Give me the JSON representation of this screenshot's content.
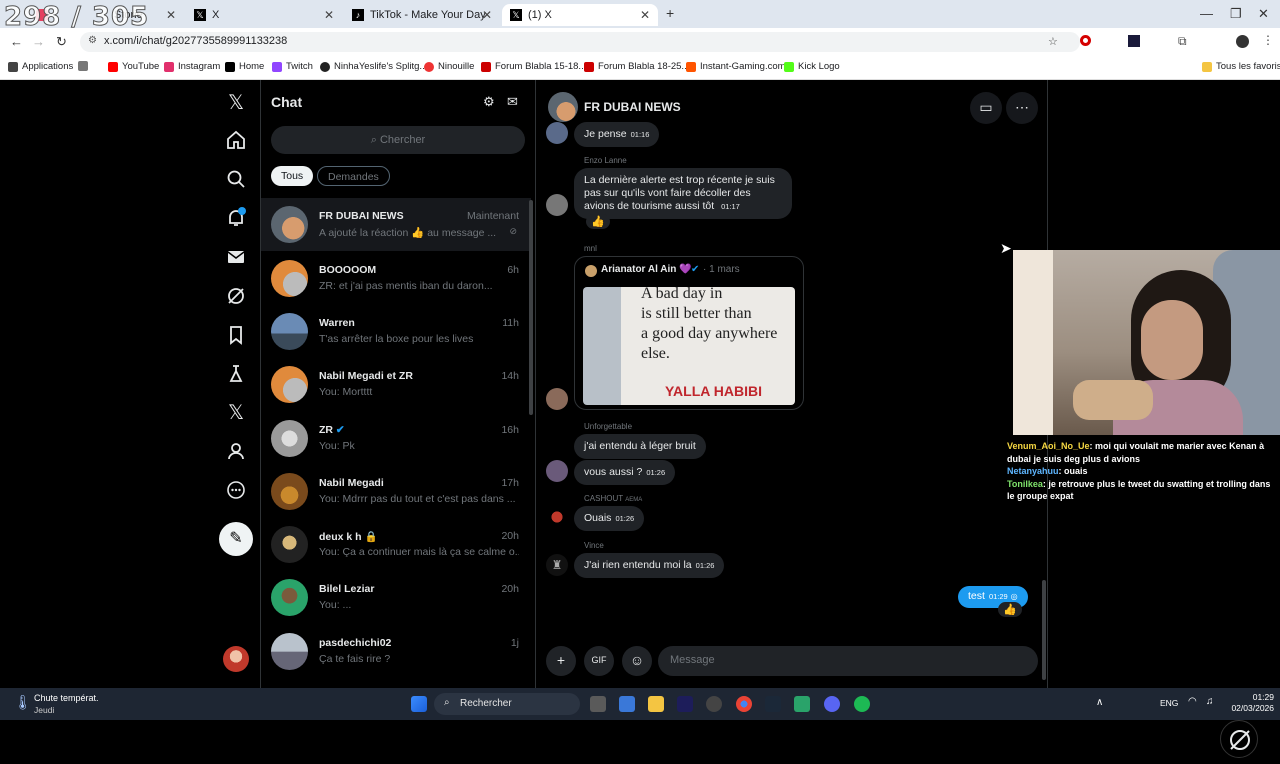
{
  "browser": {
    "counter": "298 / 305",
    "tabs": [
      {
        "label": "d Sr",
        "stories": "Storie"
      },
      {
        "label": "X"
      },
      {
        "label": "TikTok - Make Your Day"
      },
      {
        "label": "(1) X"
      }
    ],
    "url": "x.com/i/chat/g2027735589991133238",
    "bookmarks": [
      "Applications",
      "YouTube",
      "Instagram",
      "Home",
      "Twitch",
      "NinhaYeslife's Splitg...",
      "Ninouille",
      "Forum Blabla 15-18...",
      "Forum Blabla 18-25...",
      "Instant-Gaming.com",
      "Kick Logo"
    ],
    "all_favorites": "Tous les favoris"
  },
  "chat_list": {
    "title": "Chat",
    "search_placeholder": "Chercher",
    "filters": [
      "Tous",
      "Demandes"
    ],
    "conversations": [
      {
        "name": "FR DUBAI NEWS",
        "time": "Maintenant",
        "preview": "A ajouté la réaction 👍 au message ..."
      },
      {
        "name": "BOOOOOM",
        "time": "6h",
        "preview": "ZR: et j'ai pas mentis iban du daron..."
      },
      {
        "name": "Warren",
        "time": "11h",
        "preview": "T'as arrêter la boxe pour les lives"
      },
      {
        "name": "Nabil Megadi et ZR",
        "time": "14h",
        "preview": "You: Mortttt"
      },
      {
        "name": "ZR",
        "time": "16h",
        "preview": "You: Pk"
      },
      {
        "name": "Nabil Megadi",
        "time": "17h",
        "preview": "You: Mdrrr pas du tout et c'est pas dans ..."
      },
      {
        "name": "deux k h 🔒",
        "time": "20h",
        "preview": "You: Ça a continuer mais là ça se calme o..."
      },
      {
        "name": "Bilel Leziar",
        "time": "20h",
        "preview": "You: ..."
      },
      {
        "name": "pasdechichi02",
        "time": "1j",
        "preview": "Ça te fais rire ?"
      }
    ]
  },
  "conversation": {
    "title": "FR DUBAI NEWS",
    "messages": [
      {
        "sender": "",
        "text": "Je pense",
        "time": "01:16"
      },
      {
        "sender": "Enzo Lanne",
        "text": "La dernière alerte est trop récente je suis pas sur qu'ils vont faire décoller des avions de tourisme aussi tôt",
        "time": "01:17",
        "reaction": "👍"
      },
      {
        "sender": "mnl",
        "quote_author": "Arianator Al Ain 💜",
        "quote_date": "1 mars",
        "quote_lines": [
          "A bad day in",
          "is still better than",
          "a good day anywhere",
          "else.",
          "YALLA HABIBI"
        ]
      },
      {
        "sender": "Unforgettable",
        "text": "j'ai entendu à léger bruit"
      },
      {
        "sender": "",
        "text": "vous aussi ?",
        "time": "01:26"
      },
      {
        "sender": "CASHOUT",
        "sender_tag": "AEMA",
        "text": "Ouais",
        "time": "01:26"
      },
      {
        "sender": "Vince",
        "text": "J'ai rien entendu moi la",
        "time": "01:26"
      }
    ],
    "mine": {
      "text": "test",
      "time": "01:29",
      "reaction": "👍"
    },
    "message_placeholder": "Message"
  },
  "stream_chat": [
    {
      "user": "Venum_Aoi_No_Ue",
      "text": "moi qui voulait me marier avec Kenan à dubai je suis deg plus d avions"
    },
    {
      "user": "Netanyahuu",
      "text": "ouais"
    },
    {
      "user": "Tonilkea",
      "text": "je retrouve plus le tweet du swatting et trolling dans le groupe expat"
    }
  ],
  "taskbar": {
    "weather_title": "Chute températ.",
    "weather_sub": "Jeudi",
    "search": "Rechercher",
    "lang": "ENG",
    "time": "01:29",
    "date": "02/03/2026"
  }
}
